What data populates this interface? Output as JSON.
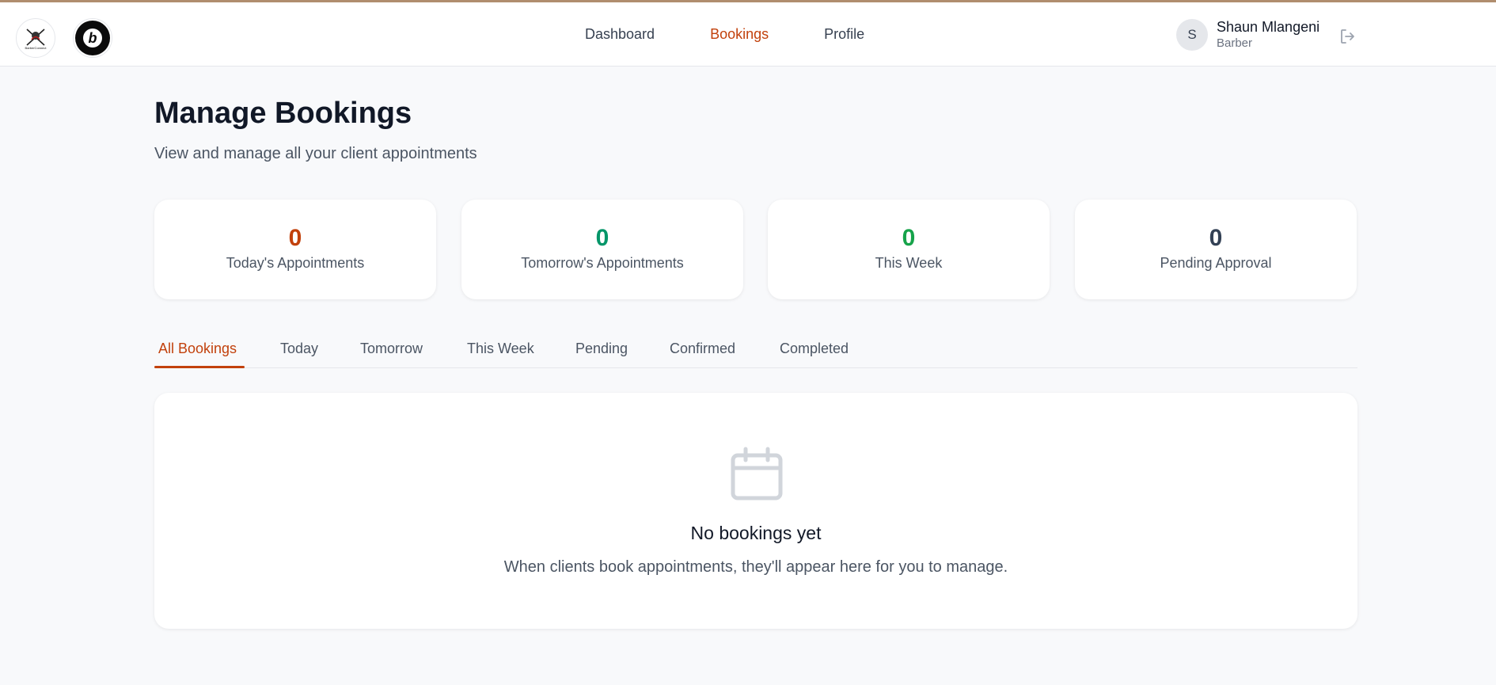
{
  "header": {
    "logo1_text": "BarberConnect",
    "logo2_text": "b",
    "nav": [
      {
        "label": "Dashboard",
        "active": false
      },
      {
        "label": "Bookings",
        "active": true
      },
      {
        "label": "Profile",
        "active": false
      }
    ],
    "user": {
      "initial": "S",
      "name": "Shaun Mlangeni",
      "role": "Barber"
    }
  },
  "page": {
    "title": "Manage Bookings",
    "subtitle": "View and manage all your client appointments"
  },
  "stats": [
    {
      "value": "0",
      "label": "Today's Appointments",
      "color": "#c2410c"
    },
    {
      "value": "0",
      "label": "Tomorrow's Appointments",
      "color": "#059669"
    },
    {
      "value": "0",
      "label": "This Week",
      "color": "#16a34a"
    },
    {
      "value": "0",
      "label": "Pending Approval",
      "color": "#334155"
    }
  ],
  "tabs": [
    {
      "label": "All Bookings",
      "active": true
    },
    {
      "label": "Today",
      "active": false
    },
    {
      "label": "Tomorrow",
      "active": false
    },
    {
      "label": "This Week",
      "active": false
    },
    {
      "label": "Pending",
      "active": false
    },
    {
      "label": "Confirmed",
      "active": false
    },
    {
      "label": "Completed",
      "active": false
    }
  ],
  "empty_state": {
    "icon": "calendar-icon",
    "title": "No bookings yet",
    "description": "When clients book appointments, they'll appear here for you to manage."
  },
  "colors": {
    "accent": "#c2410c",
    "top_bar": "#b08d6e"
  }
}
